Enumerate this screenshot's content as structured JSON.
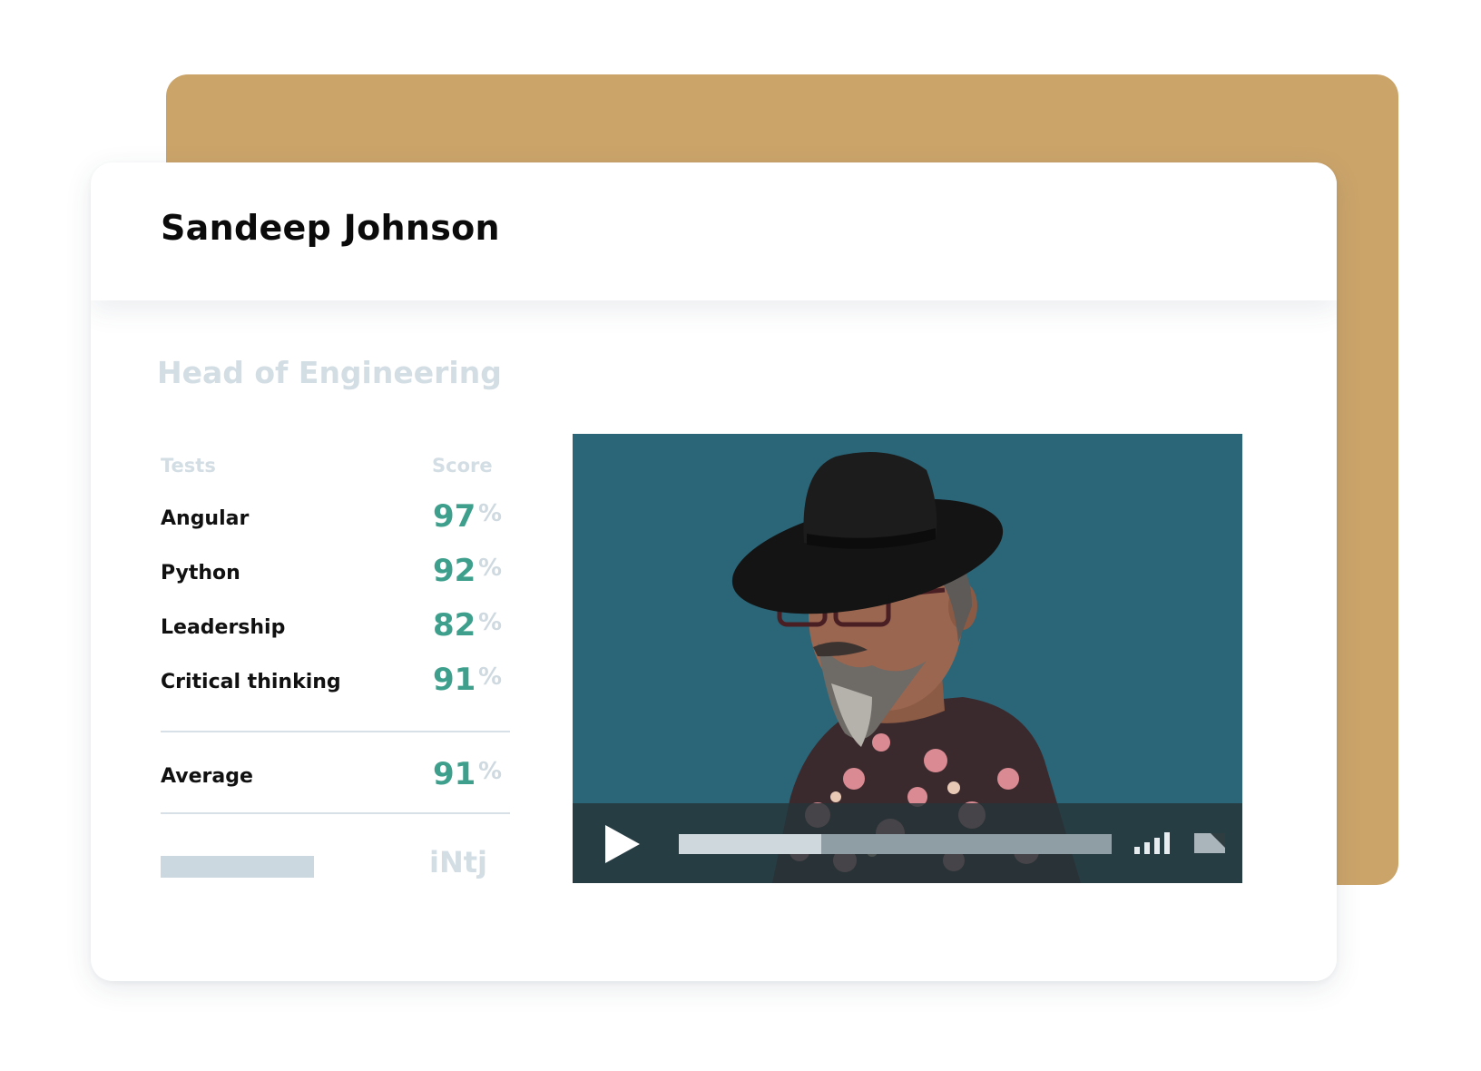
{
  "candidate": {
    "name": "Sandeep Johnson",
    "role": "Head of Engineering"
  },
  "results": {
    "tests_header": "Tests",
    "score_header": "Score",
    "percent_symbol": "%",
    "rows": [
      {
        "test": "Angular",
        "score": "97"
      },
      {
        "test": "Python",
        "score": "92"
      },
      {
        "test": "Leadership",
        "score": "82"
      },
      {
        "test": "Critical thinking",
        "score": "91"
      }
    ],
    "average_label": "Average",
    "average_score": "91",
    "personality_type": "iNtj"
  },
  "video": {
    "progress_fraction": 0.33,
    "volume_level_bars": 4
  },
  "colors": {
    "backdrop": "#cba46a",
    "score_accent": "#3ea08c",
    "video_background": "#2b6678",
    "muted_text": "#d3dde4"
  },
  "icons": {
    "play": "play-icon",
    "volume": "volume-bars-icon",
    "fullscreen": "fullscreen-icon",
    "percent": "percent-icon"
  }
}
